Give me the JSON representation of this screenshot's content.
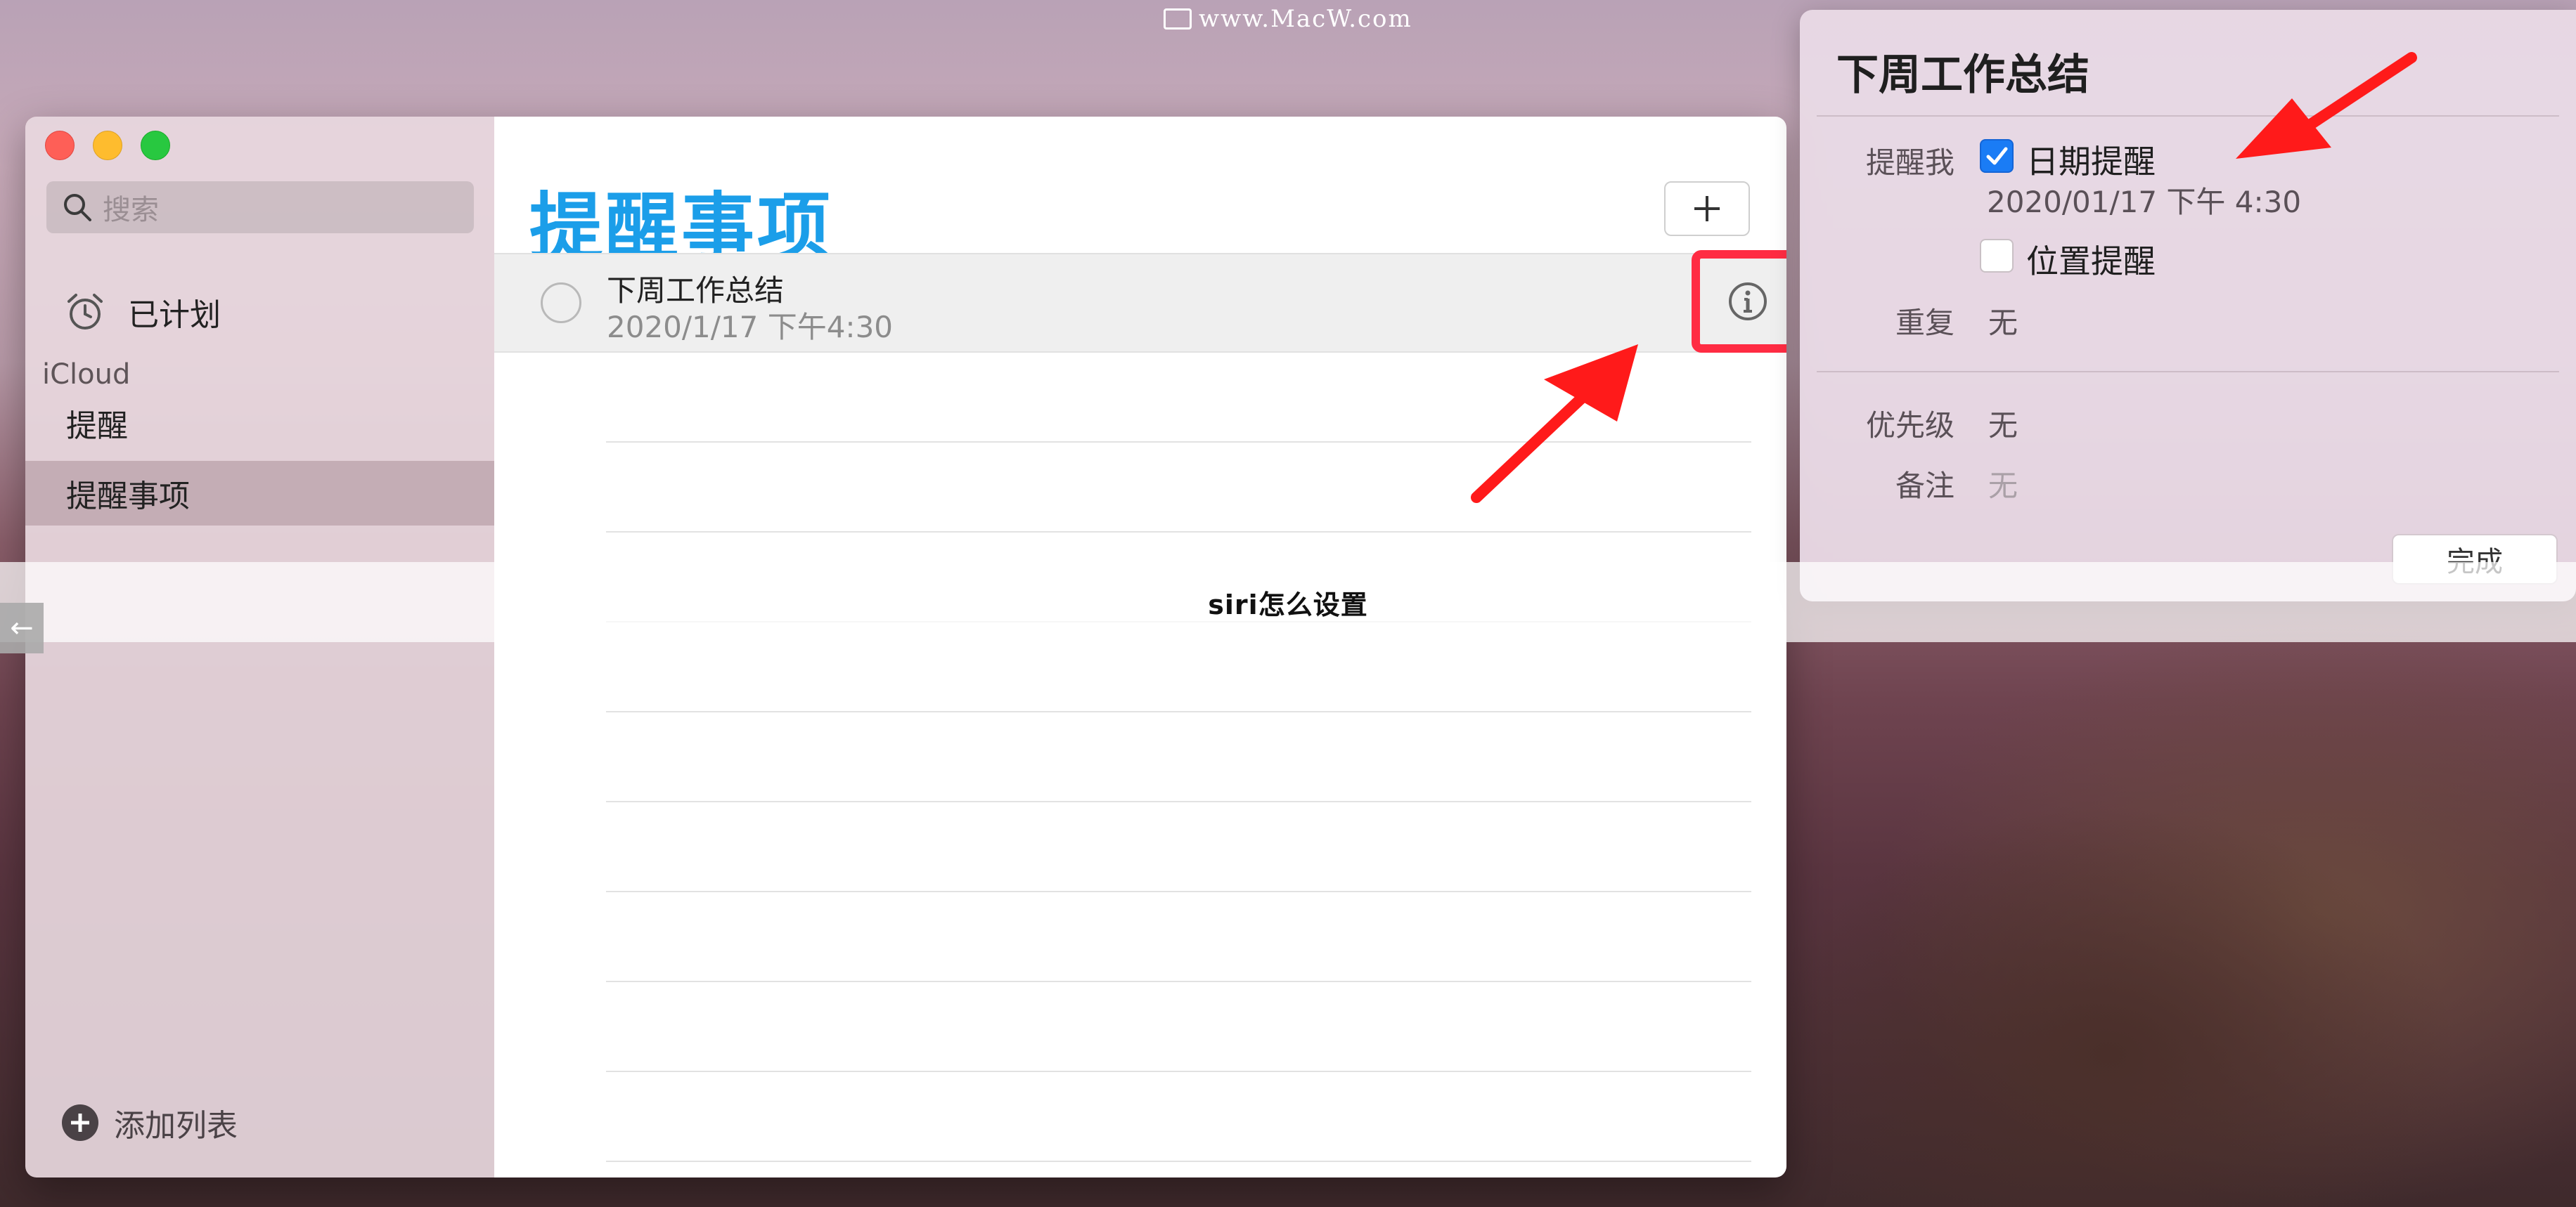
{
  "watermark": "www.MacW.com",
  "sidebar": {
    "search_placeholder": "搜索",
    "scheduled": "已计划",
    "section": "iCloud",
    "lists": [
      {
        "label": "提醒"
      },
      {
        "label": "提醒事项"
      }
    ],
    "add_list": "添加列表"
  },
  "main": {
    "title": "提醒事项",
    "add_symbol": "+",
    "task": {
      "title": "下周工作总结",
      "date": "2020/1/17 下午4:30"
    }
  },
  "banner": {
    "text": "siri怎么设置",
    "arrow": "←"
  },
  "detail": {
    "title": "下周工作总结",
    "remind_me_label": "提醒我",
    "date_reminder_label": "日期提醒",
    "date_reminder_checked": true,
    "date_value": "2020/01/17  下午  4:30",
    "location_reminder_label": "位置提醒",
    "location_reminder_checked": false,
    "repeat_label": "重复",
    "repeat_value": "无",
    "priority_label": "优先级",
    "priority_value": "无",
    "notes_label": "备注",
    "notes_value": "无",
    "done_label": "完成"
  },
  "colors": {
    "accent_title": "#1b9ee9",
    "highlight_box": "#ff2c43",
    "checkbox_on": "#1a7cf5"
  }
}
